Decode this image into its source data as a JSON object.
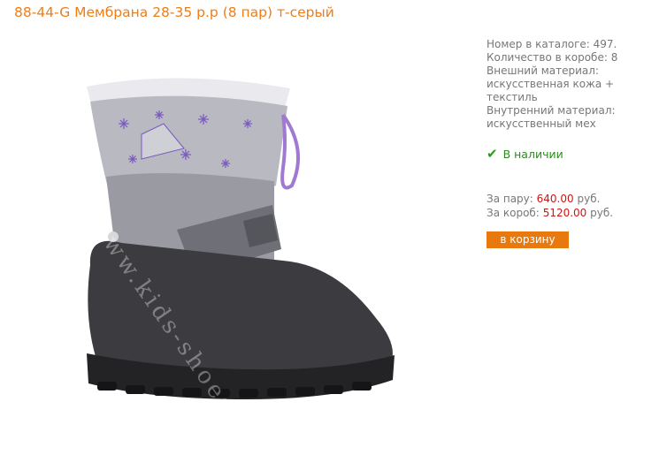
{
  "product": {
    "title": "88-44-G Мембрана 28-35 р.р (8 пар) т-серый",
    "image_alt": "Детский зимний сапог серого цвета",
    "watermark": "www.kids-shoes.ru"
  },
  "info": {
    "catalog_number": "Номер в каталоге: 497.",
    "box_quantity": "Количество в коробе: 8",
    "outer_material_label": "Внешний материал:",
    "outer_material_value_1": "искусственная кожа +",
    "outer_material_value_2": "текстиль",
    "inner_material_label": "Внутренний материал:",
    "inner_material_value": "искусственный мех"
  },
  "stock": {
    "icon": "check-icon",
    "label": "В наличии",
    "color": "#2f9a20"
  },
  "prices": {
    "pair_label": "За пару:",
    "pair_price": "640.00",
    "pair_currency": "руб.",
    "box_label": "За короб:",
    "box_price": "5120.00",
    "box_currency": "руб.",
    "price_color": "#d01515"
  },
  "cart": {
    "button_label": "в корзину",
    "button_color": "#e8790e"
  },
  "colors": {
    "title": "#f07d16",
    "text": "#777777"
  }
}
